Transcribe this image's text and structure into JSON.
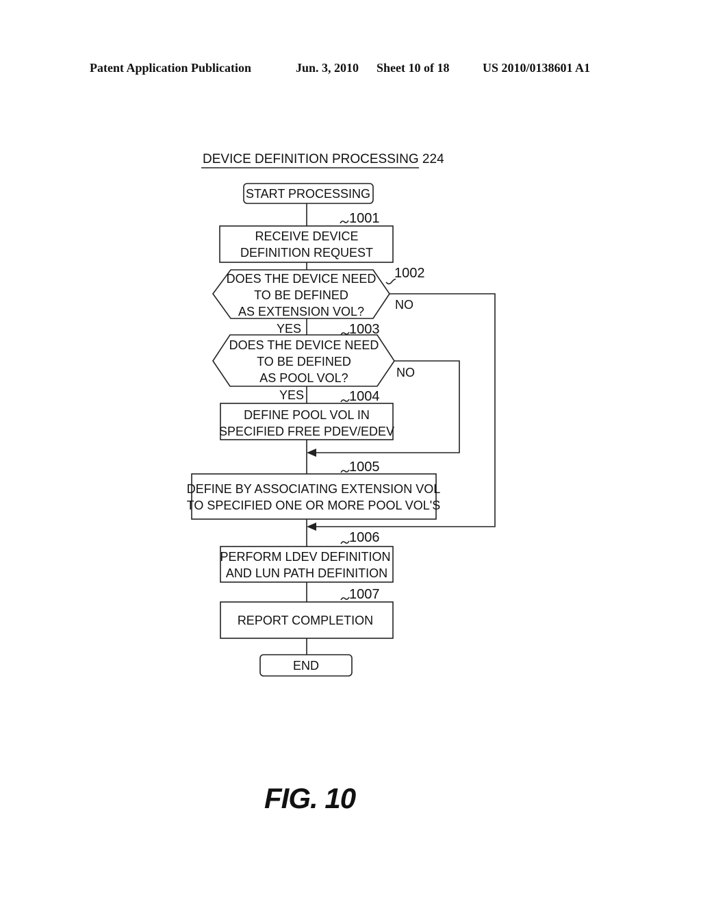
{
  "header": {
    "publication": "Patent Application Publication",
    "date": "Jun. 3, 2010",
    "sheet": "Sheet 10 of 18",
    "number": "US 2010/0138601 A1"
  },
  "diagram": {
    "title": "DEVICE DEFINITION PROCESSING 224",
    "start": "START PROCESSING",
    "end": "END",
    "steps": [
      {
        "ref": "1001",
        "lines": [
          "RECEIVE DEVICE",
          "DEFINITION REQUEST"
        ]
      },
      {
        "ref": "1002",
        "lines": [
          "DOES THE DEVICE NEED",
          "TO BE DEFINED",
          "AS EXTENSION VOL?"
        ]
      },
      {
        "ref": "1003",
        "lines": [
          "DOES THE DEVICE NEED",
          "TO BE DEFINED",
          "AS POOL VOL?"
        ]
      },
      {
        "ref": "1004",
        "lines": [
          "DEFINE POOL VOL IN",
          "SPECIFIED FREE PDEV/EDEV"
        ]
      },
      {
        "ref": "1005",
        "lines": [
          "DEFINE BY ASSOCIATING EXTENSION VOL",
          "TO SPECIFIED ONE OR MORE POOL VOL'S"
        ]
      },
      {
        "ref": "1006",
        "lines": [
          "PERFORM LDEV DEFINITION",
          "AND LUN PATH DEFINITION"
        ]
      },
      {
        "ref": "1007",
        "lines": [
          "REPORT COMPLETION"
        ]
      }
    ],
    "branch_labels": {
      "yes": "YES",
      "no": "NO"
    }
  },
  "figure_label": "FIG. 10"
}
